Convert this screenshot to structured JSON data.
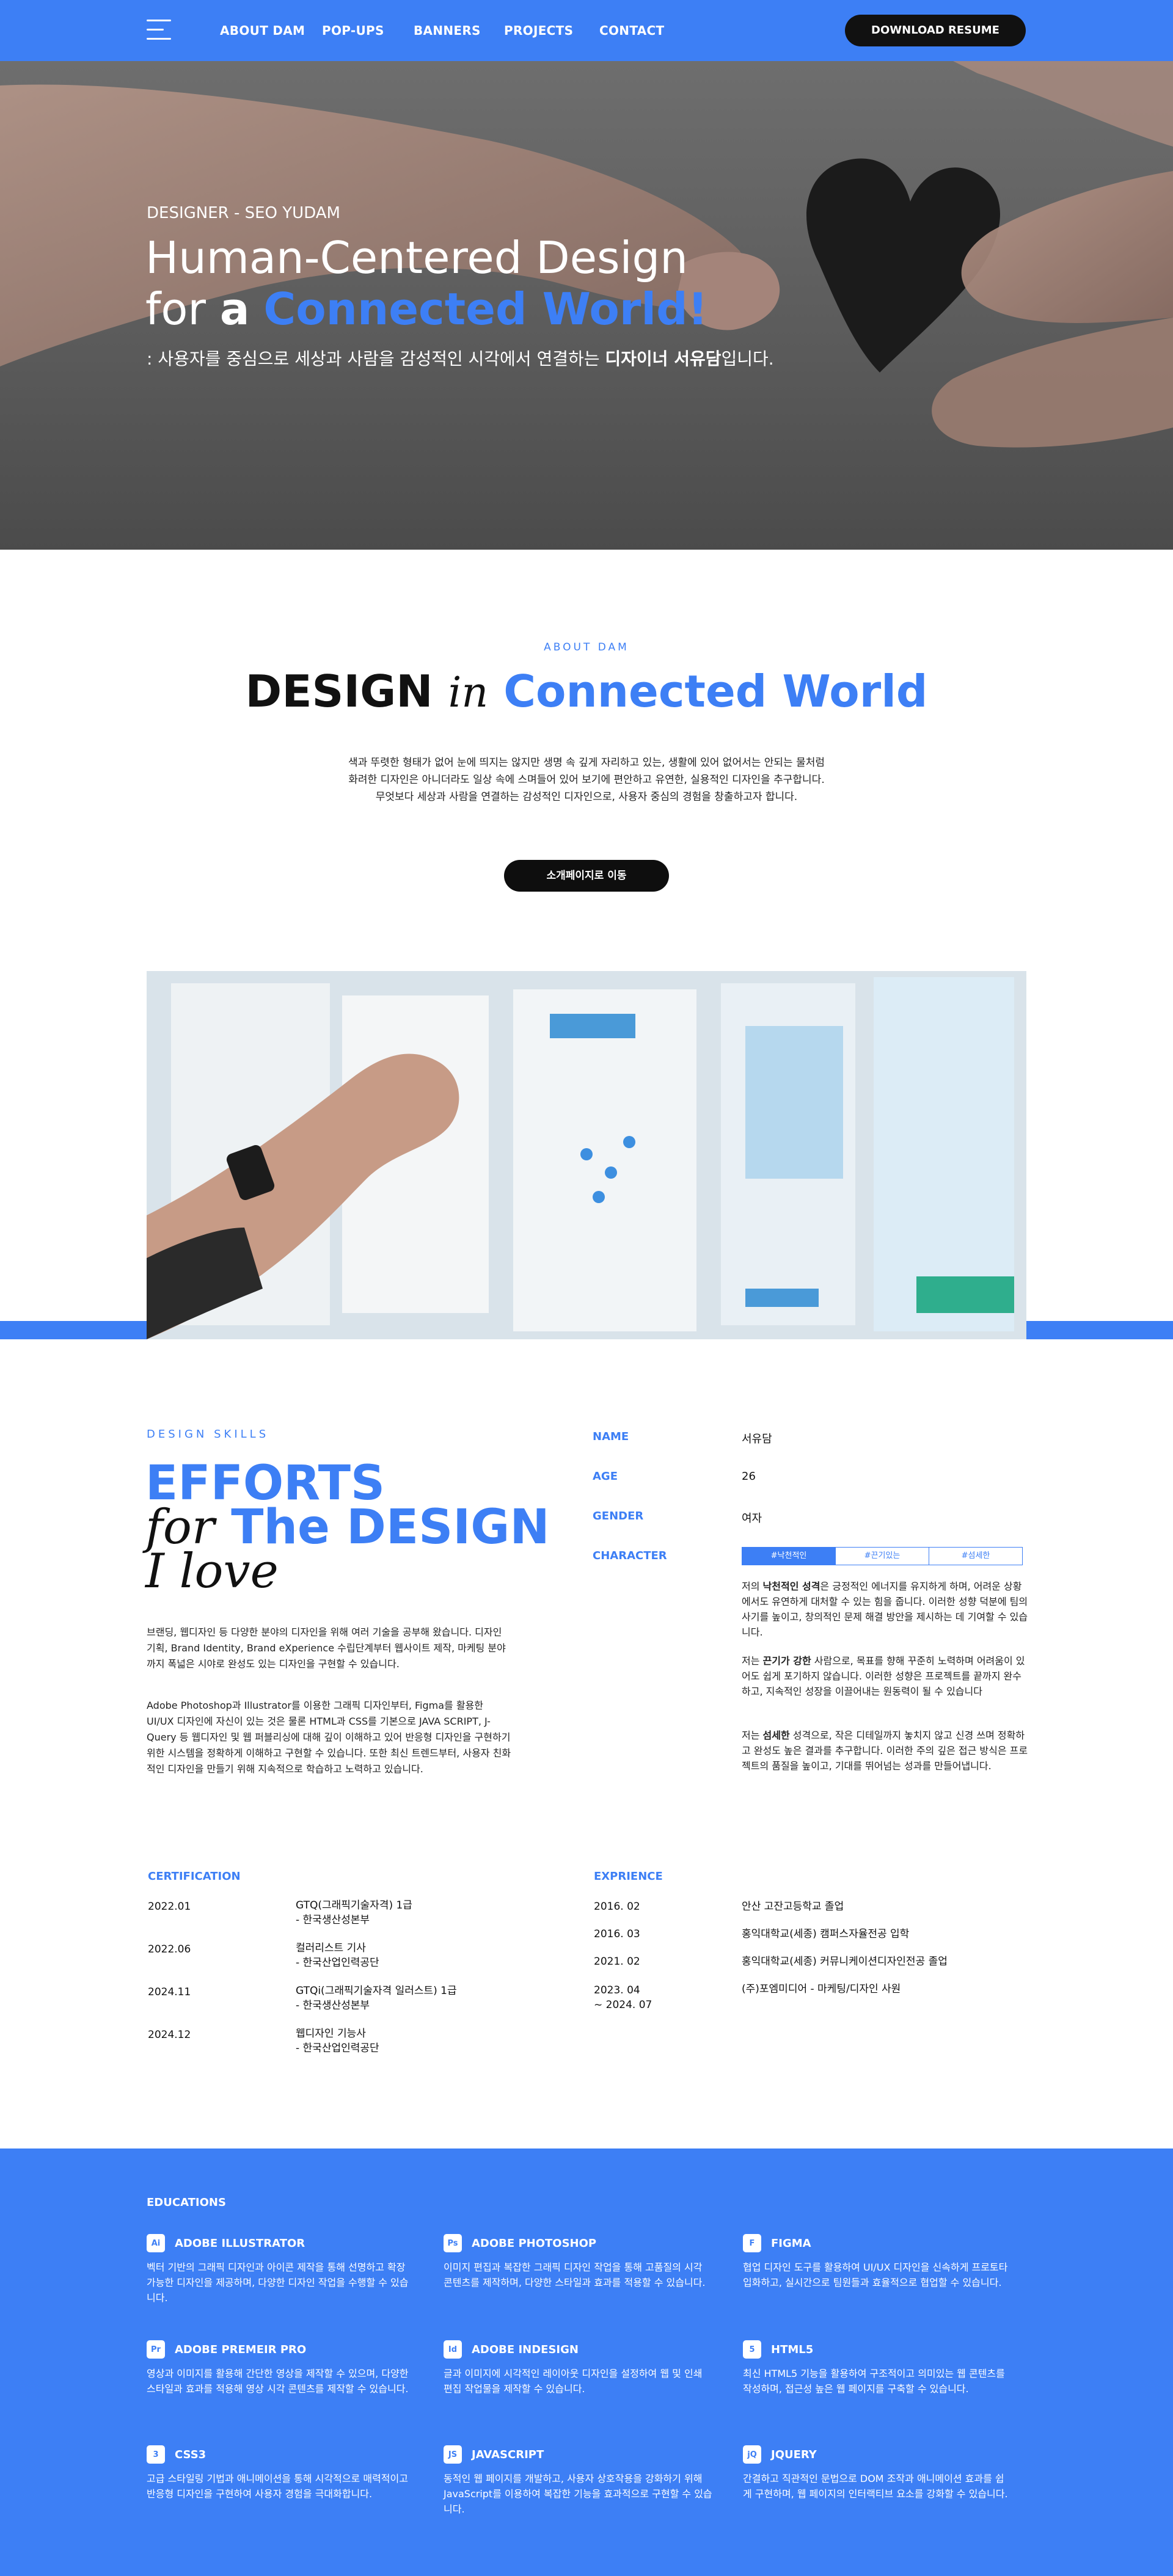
{
  "nav": {
    "links": [
      "ABOUT DAM",
      "POP-UPS",
      "BANNERS",
      "PROJECTS",
      "CONTACT"
    ],
    "resume_button": "DOWNLOAD RESUME"
  },
  "hero": {
    "kicker": "DESIGNER - SEO YUDAM",
    "title_line1": "Human-Centered Design",
    "title_for": "for",
    "title_a": "a",
    "title_highlight": "Connected World!",
    "subtitle_prefix": ": 사용자를 중심으로 세상과 사람을 감성적인 시각에서 연결하는",
    "subtitle_bold": "디자이너 서유담",
    "subtitle_suffix": "입니다."
  },
  "about": {
    "kicker": "ABOUT DAM",
    "title_design": "DESIGN",
    "title_in": "in",
    "title_connected": "Connected World",
    "paragraph_lines": [
      "색과 뚜렷한 형태가 없어 눈에 띄지는 않지만 생명 속 깊게 자리하고 있는, 생활에 있어 없어서는 안되는 물처럼",
      "화려한 디자인은 아니더라도 일상 속에 스며들어 있어 보기에 편안하고 유연한, 실용적인 디자인을 추구합니다.",
      "무엇보다 세상과 사람을 연결하는 감성적인 디자인으로, 사용자 중심의 경험을 창출하고자 합니다."
    ],
    "intro_button": "소개페이지로 이동"
  },
  "skills": {
    "kicker": "DESIGN SKILLS",
    "line1": "EFFORTS",
    "line2_script": "for",
    "line2_bold": "The DESIGN",
    "line3_script": "I love",
    "para1": "브랜딩, 웹디자인 등 다양한 분야의 디자인을 위해 여러 기술을 공부해 왔습니다. 디자인 기획, Brand Identity, Brand eXperience 수립단계부터 웹사이트 제작, 마케팅 분야까지 폭넓은 시야로 완성도 있는 디자인을 구현할 수 있습니다.",
    "para2": "Adobe Photoshop과 Illustrator를 이용한 그래픽 디자인부터, Figma를 활용한 UI/UX 디자인에 자신이 있는 것은 물론 HTML과 CSS를 기본으로 JAVA SCRIPT, J-Query 등 웹디자인 및 웹 퍼블리싱에 대해 깊이 이해하고 있어 반응형 디자인을 구현하기 위한 시스템을 정확하게 이해하고 구현할 수 있습니다. 또한 최신 트렌드부터, 사용자 친화적인 디자인을 만들기 위해 지속적으로 학습하고 노력하고 있습니다."
  },
  "profile": {
    "name_label": "NAME",
    "name_value": "서유담",
    "age_label": "AGE",
    "age_value": "26",
    "gender_label": "GENDER",
    "gender_value": "여자",
    "character_label": "CHARACTER",
    "tabs": [
      "#낙천적인",
      "#끈기있는",
      "#섬세한"
    ],
    "char1_prefix": "저의 ",
    "char1_bold": "낙천적인 성격",
    "char1_rest": "은 긍정적인 에너지를 유지하게 하며, 어려운 상황에서도 유연하게 대처할 수 있는 힘을 줍니다. 이러한 성향 덕분에 팀의 사기를 높이고, 창의적인 문제 해결 방안을 제시하는 데 기여할 수 있습니다.",
    "char2_prefix": "저는 ",
    "char2_bold": "끈기가 강한",
    "char2_rest": " 사람으로, 목표를 향해 꾸준히 노력하며 어려움이 있어도 쉽게 포기하지 않습니다. 이러한 성향은 프로젝트를 끝까지 완수하고, 지속적인 성장을 이끌어내는 원동력이 될 수 있습니다",
    "char3_prefix": "저는 ",
    "char3_bold": "섬세한",
    "char3_rest": " 성격으로, 작은 디테일까지 놓치지 않고 신경 쓰며 정확하고 완성도 높은 결과를 추구합니다. 이러한 주의 깊은 접근 방식은 프로젝트의 품질을 높이고, 기대를 뛰어넘는 성과를 만들어냅니다."
  },
  "certification": {
    "label": "CERTIFICATION",
    "items": [
      {
        "date": "2022.01",
        "title": "GTQ(그래픽기술자격) 1급",
        "issuer": "- 한국생산성본부"
      },
      {
        "date": "2022.06",
        "title": "컬러리스트 기사",
        "issuer": "- 한국산업인력공단"
      },
      {
        "date": "2024.11",
        "title": "GTQi(그래픽기술자격 일러스트) 1급",
        "issuer": "- 한국생산성본부"
      },
      {
        "date": "2024.12",
        "title": "웹디자인 기능사",
        "issuer": "- 한국산업인력공단"
      }
    ]
  },
  "experience": {
    "label": "EXPRIENCE",
    "items": [
      {
        "date": "2016. 02",
        "date2": "",
        "text": "안산 고잔고등학교 졸업"
      },
      {
        "date": "2016. 03",
        "date2": "",
        "text": "홍익대학교(세종) 캠퍼스자율전공 입학"
      },
      {
        "date": "2021. 02",
        "date2": "",
        "text": "홍익대학교(세종) 커뮤니케이션디자인전공 졸업"
      },
      {
        "date": "2023. 04",
        "date2": "~  2024. 07",
        "text": "(주)포엠미디어 - 마케팅/디자인 사원"
      }
    ]
  },
  "educations": {
    "label": "EDUCATIONS",
    "items": [
      {
        "icon": "Ai",
        "name": "ADOBE ILLUSTRATOR",
        "desc": "벡터 기반의 그래픽 디자인과 아이콘 제작을 통해 선명하고 확장 가능한 디자인을 제공하며, 다양한 디자인 작업을 수행할 수 있습니다."
      },
      {
        "icon": "Ps",
        "name": "ADOBE PHOTOSHOP",
        "desc": "이미지 편집과 복잡한 그래픽 디자인 작업을 통해 고품질의 시각 콘텐츠를 제작하며, 다양한 스타일과 효과를 적용할 수 있습니다."
      },
      {
        "icon": "F",
        "name": "FIGMA",
        "desc": "협업 디자인 도구를 활용하여 UI/UX 디자인을 신속하게 프로토타입화하고, 실시간으로 팀원들과 효율적으로 협업할 수 있습니다."
      },
      {
        "icon": "Pr",
        "name": "ADOBE PREMEIR PRO",
        "desc": "영상과 이미지를 활용해 간단한 영상을 제작할 수 있으며, 다양한 스타일과 효과를 적용해 영상 시각 콘텐츠를 제작할 수 있습니다."
      },
      {
        "icon": "Id",
        "name": "ADOBE INDESIGN",
        "desc": "글과 이미지에 시각적인 레이아웃 디자인을 설정하여 웹 및 인쇄 편집 작업물을 제작할 수 있습니다."
      },
      {
        "icon": "5",
        "name": "HTML5",
        "desc": "최신 HTML5 기능을 활용하여 구조적이고 의미있는 웹 콘텐츠를 작성하며, 접근성 높은 웹 페이지를 구축할 수 있습니다."
      },
      {
        "icon": "3",
        "name": "CSS3",
        "desc": "고급 스타일링 기법과 애니메이션을 통해 시각적으로 매력적이고 반응형 디자인을 구현하여 사용자 경험을 극대화합니다."
      },
      {
        "icon": "JS",
        "name": "JAVASCRIPT",
        "desc": "동적인 웹 페이지를 개발하고, 사용자 상호작용을 강화하기 위해 JavaScript를 이용하여 복잡한 기능을 효과적으로 구현할 수 있습니다."
      },
      {
        "icon": "jQ",
        "name": "JQUERY",
        "desc": "간결하고 직관적인 문법으로 DOM 조작과 애니메이션 효과를 쉽게 구현하며, 웹 페이지의 인터랙티브 요소를 강화할 수 있습니다."
      }
    ]
  }
}
